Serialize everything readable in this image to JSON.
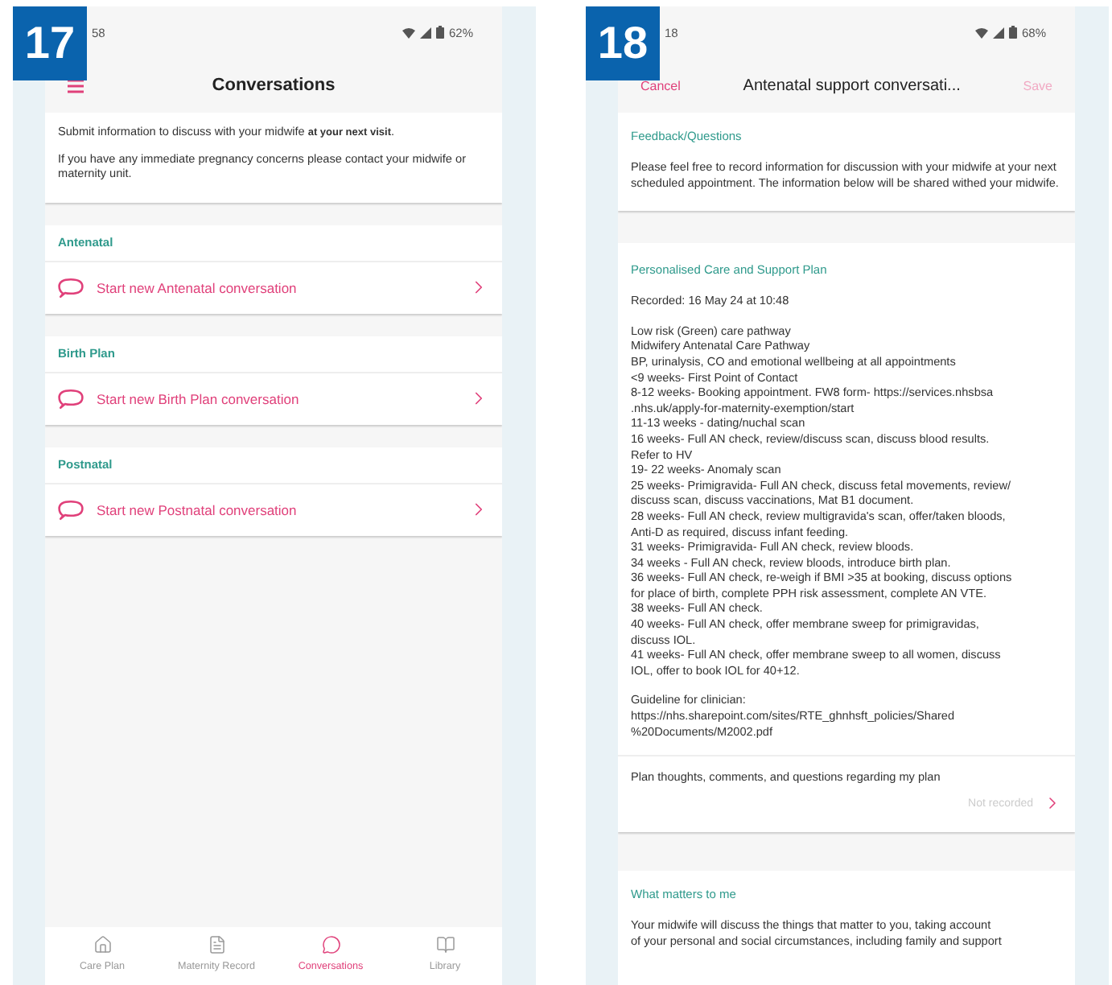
{
  "conversations_screen": {
    "badge": "17",
    "status": {
      "time": "58",
      "battery": "62%"
    },
    "header": {
      "title": "Conversations"
    },
    "intro": [
      "Submit information to discuss with your midwife **at your next visit**.",
      "If you have any immediate pregnancy concerns please contact your midwife or maternity unit."
    ],
    "sections": [
      {
        "label": "Antenatal",
        "action": "Start new Antenatal conversation"
      },
      {
        "label": "Birth Plan",
        "action": "Start new Birth Plan conversation"
      },
      {
        "label": "Postnatal",
        "action": "Start new Postnatal conversation"
      }
    ],
    "nav": [
      {
        "label": "Care Plan",
        "selected": false
      },
      {
        "label": "Maternity Record",
        "selected": false
      },
      {
        "label": "Conversations",
        "selected": true
      },
      {
        "label": "Library",
        "selected": false
      }
    ]
  },
  "conversation_form_screen": {
    "badge": "18",
    "status": {
      "time": "18",
      "battery": "68%"
    },
    "header": {
      "cancel": "Cancel",
      "title": "Antenatal support conversati...",
      "save": "Save"
    },
    "feedback": {
      "title": "Feedback/Questions",
      "text": "Please feel free to record information for discussion with your midwife at your next scheduled appointment. The information below will be shared withed your midwife."
    },
    "plan": {
      "title": "Personalised Care and Support Plan",
      "recorded": "Recorded: 16 May 24 at 10:48",
      "lines": [
        "Low risk (Green) care pathway",
        "Midwifery Antenatal Care Pathway",
        " BP, urinalysis, CO and emotional wellbeing at all appointments",
        "<9 weeks- First Point of Contact",
        "8-12 weeks- Booking appointment. FW8 form- https://services.nhsbsa",
        ".nhs.uk/apply-for-maternity-exemption/start",
        "11-13 weeks - dating/nuchal scan",
        "16 weeks- Full AN check, review/discuss scan, discuss blood results.",
        "Refer to HV",
        "19- 22 weeks- Anomaly scan",
        "25  weeks- Primigravida- Full AN check, discuss fetal movements, review/",
        "discuss scan, discuss vaccinations, Mat B1 document.",
        "28 weeks- Full AN check, review multigravida's scan, offer/taken bloods,",
        "Anti-D as required, discuss infant feeding.",
        "31  weeks- Primigravida- Full AN check, review bloods.",
        "34 weeks -  Full AN check, review bloods, introduce birth plan.",
        "36 weeks- Full AN check, re-weigh if BMI >35 at booking, discuss options",
        "for place of birth, complete PPH risk assessment, complete AN VTE.",
        "38 weeks- Full AN check.",
        "40 weeks- Full AN check, offer membrane sweep for primigravidas,",
        "discuss IOL.",
        "41 weeks- Full AN check, offer membrane sweep to all women, discuss",
        "IOL, offer to book IOL for 40+12."
      ],
      "guideline": [
        "Guideline for clinician:",
        "https://nhs.sharepoint.com/sites/RTE_ghnhsft_policies/Shared",
        "%20Documents/M2002.pdf"
      ]
    },
    "plan_comments": {
      "label": "Plan thoughts, comments, and questions regarding my plan",
      "value": "Not recorded"
    },
    "what_matters": {
      "title": "What matters to me",
      "lines": [
        "Your midwife will discuss the things that matter to you, taking account",
        "of your personal and social circumstances, including family and support"
      ]
    }
  }
}
